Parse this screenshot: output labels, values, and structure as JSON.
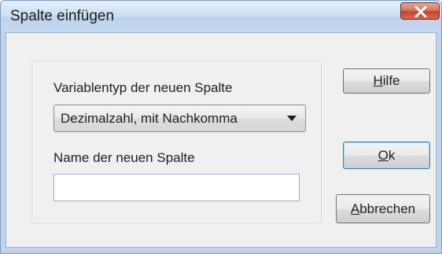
{
  "window": {
    "title": "Spalte einfügen",
    "close_icon": "close-x-icon"
  },
  "form": {
    "type_label": "Variablentyp der neuen Spalte",
    "type_selected": "Dezimalzahl, mit Nachkomma",
    "name_label": "Name der neuen Spalte",
    "name_value": "",
    "name_placeholder": ""
  },
  "buttons": {
    "help": {
      "mnemonic": "H",
      "rest": "ilfe"
    },
    "ok": {
      "mnemonic": "O",
      "rest": "k"
    },
    "cancel": {
      "mnemonic": "A",
      "rest": "bbrechen"
    }
  },
  "colors": {
    "titlebar": "#c4d9f0",
    "close_button": "#c3432a",
    "client_background": "#f0f0f0"
  }
}
